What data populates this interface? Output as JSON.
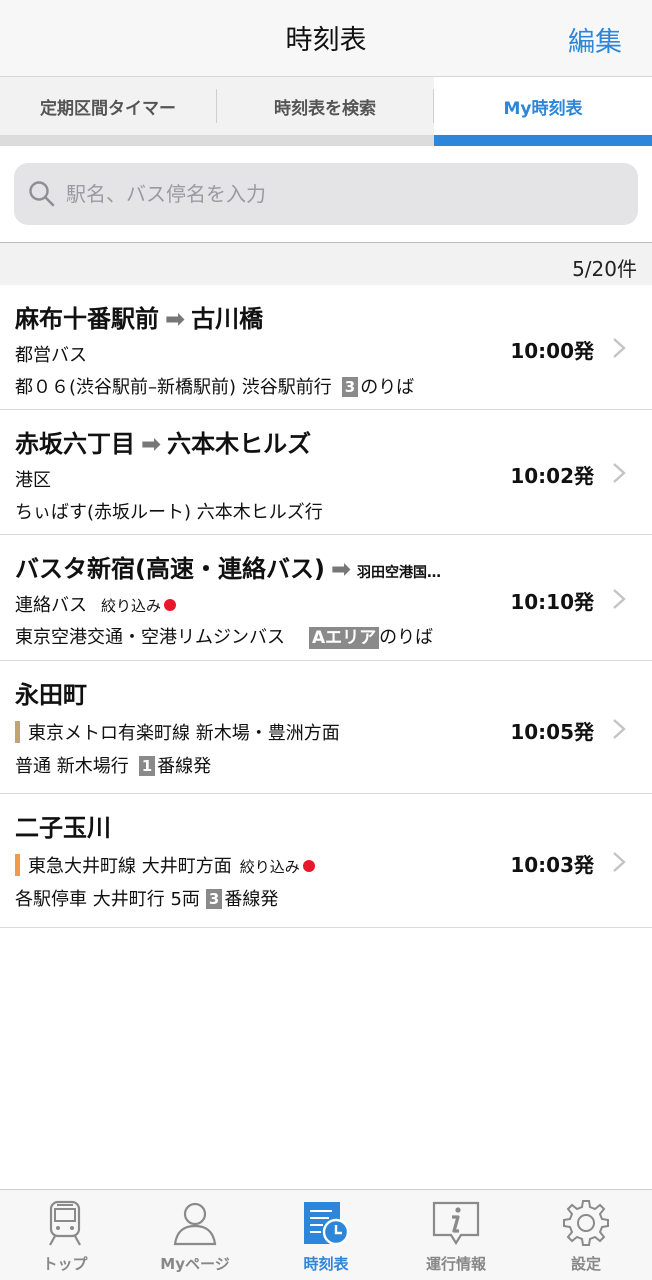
{
  "header": {
    "title": "時刻表",
    "edit_label": "編集"
  },
  "tabs": [
    {
      "label": "定期区間タイマー"
    },
    {
      "label": "時刻表を検索"
    },
    {
      "label": "My時刻表"
    }
  ],
  "search": {
    "placeholder": "駅名、バス停名を入力",
    "value": ""
  },
  "count": "5/20件",
  "rows": [
    {
      "from": "麻布十番駅前",
      "arrow": "➡",
      "to": "古川橋",
      "operator": "都営バス",
      "route": "都０６(渋谷駅前–新橋駅前) 渋谷駅前行",
      "platform_num": "3",
      "platform_label": "のりば",
      "time": "10:00発"
    },
    {
      "from": "赤坂六丁目",
      "arrow": "➡",
      "to": "六本木ヒルズ",
      "operator": "港区",
      "route": "ちぃばす(赤坂ルート) 六本木ヒルズ行",
      "time": "10:02発"
    },
    {
      "from": "バスタ新宿(高速・連絡バス)",
      "arrow": "➡",
      "to": "羽田空港国…",
      "operator": "連絡バス",
      "filter": "絞り込み",
      "route": "東京空港交通・空港リムジンバス",
      "area_badge": "Aエリア",
      "platform_label": "のりば",
      "time": "10:10発"
    },
    {
      "from": "永田町",
      "line": "東京メトロ有楽町線 新木場・豊洲方面",
      "line_color": "#c1a470",
      "service": "普通 新木場行",
      "platform_num": "1",
      "platform_label": "番線発",
      "time": "10:05発"
    },
    {
      "from": "二子玉川",
      "line": "東急大井町線 大井町方面",
      "line_color": "#f39a4a",
      "filter": "絞り込み",
      "service": "各駅停車 大井町行 5両",
      "platform_num": "3",
      "platform_label": "番線発",
      "time": "10:03発"
    }
  ],
  "tabbar": [
    {
      "label": "トップ",
      "icon": "train-icon"
    },
    {
      "label": "Myページ",
      "icon": "person-icon"
    },
    {
      "label": "時刻表",
      "icon": "timetable-icon"
    },
    {
      "label": "運行情報",
      "icon": "info-icon"
    },
    {
      "label": "設定",
      "icon": "gear-icon"
    }
  ],
  "colors": {
    "accent": "#2d86d9",
    "filter_dot": "#e8182c"
  }
}
